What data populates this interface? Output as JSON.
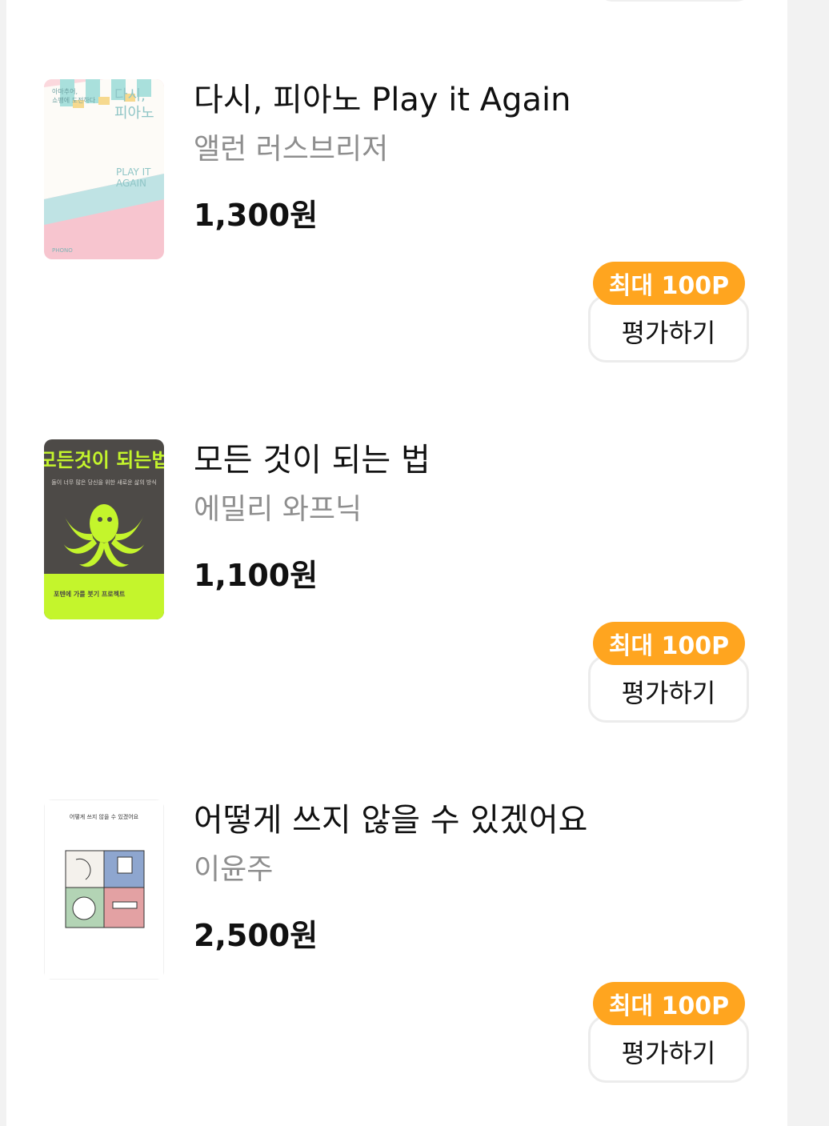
{
  "books": [
    {
      "title": "다시, 피아노 Play it Again",
      "author": "앨런 러스브리저",
      "price": "1,300원",
      "badge": "최대 100P",
      "button": "평가하기"
    },
    {
      "title": "모든 것이 되는 법",
      "author": "에밀리 와프닉",
      "price": "1,100원",
      "badge": "최대 100P",
      "button": "평가하기"
    },
    {
      "title": "어떻게 쓰지 않을 수 있겠어요",
      "author": "이윤주",
      "price": "2,500원",
      "badge": "최대 100P",
      "button": "평가하기"
    }
  ],
  "covers": {
    "piano": {
      "small_text_1": "아마추어,",
      "small_text_2": "쇼팽에 도전하다",
      "big_text_1": "다시,",
      "big_text_2": "피아노",
      "en_1": "PLAY IT",
      "en_2": "AGAIN",
      "publisher": "PHONO"
    },
    "octopus": {
      "headline": "모든것이 되는법",
      "subline": "둘이 너무 많은 당신을 위한 새로운 삶의 방식",
      "banner": "포텐에 가를 붓기 프로젝트"
    },
    "writing": {
      "headline": "어떻게 쓰지 않을 수 있겠어요"
    }
  },
  "colors": {
    "badge": "#ffa51f",
    "price": "#111111",
    "author": "#8e8e8e"
  }
}
